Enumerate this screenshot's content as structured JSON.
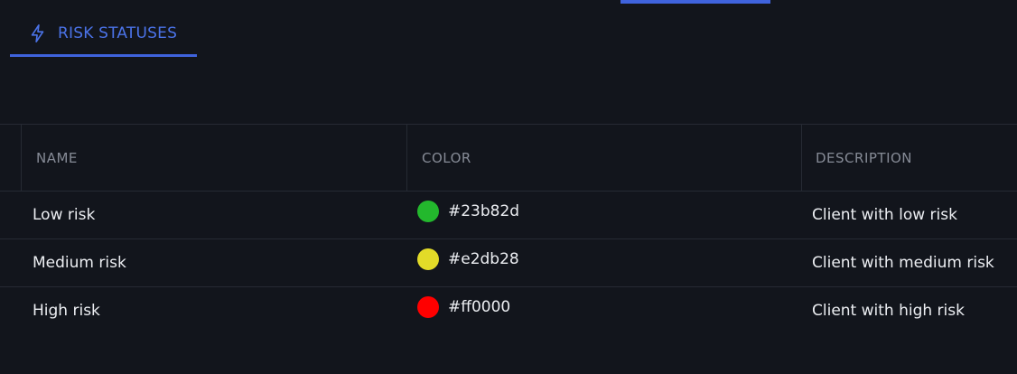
{
  "tabs": [
    {
      "label": "RISK STATUSES",
      "icon": "lightning-icon",
      "active": true
    }
  ],
  "accent_color": "#3f63dd",
  "table": {
    "columns": [
      "NAME",
      "COLOR",
      "DESCRIPTION"
    ],
    "rows": [
      {
        "name": "Low risk",
        "color": "#23b82d",
        "description": "Client with low risk"
      },
      {
        "name": "Medium risk",
        "color": "#e2db28",
        "description": "Client with medium risk"
      },
      {
        "name": "High risk",
        "color": "#ff0000",
        "description": "Client with high risk"
      }
    ]
  }
}
